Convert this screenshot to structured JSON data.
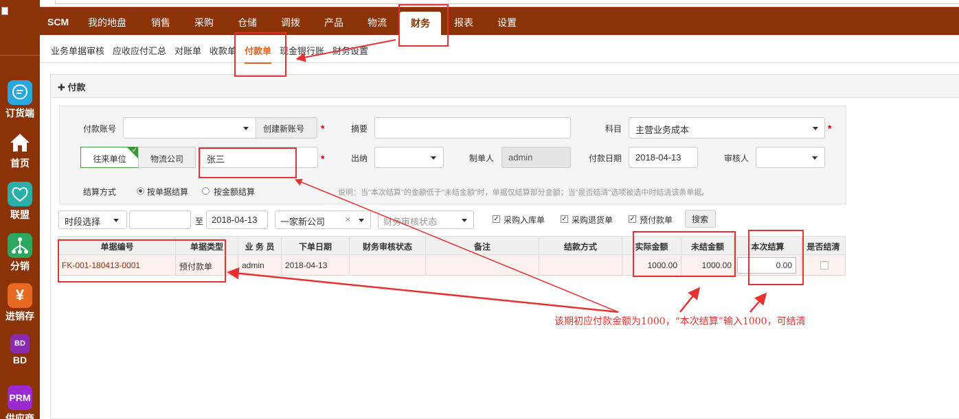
{
  "sidebar": {
    "items": [
      {
        "label": "订货端",
        "icon": "chat-icon",
        "color": "#29a8e0"
      },
      {
        "label": "首页",
        "icon": "home-icon",
        "color": "#8b3207"
      },
      {
        "label": "联盟",
        "icon": "handshake-icon",
        "color": "#2ab0a8"
      },
      {
        "label": "分销",
        "icon": "network-icon",
        "color": "#2aa860"
      },
      {
        "label": "进销存",
        "icon": "yen-icon",
        "color": "#e86a20"
      },
      {
        "label": "BD",
        "icon": "bd-icon",
        "color": "#8a2ab0"
      },
      {
        "label": "供应商",
        "icon": "prm-icon",
        "color": "#9a2ad0"
      }
    ],
    "bd_badge": "BD",
    "prm_badge": "PRM",
    "yen_glyph": "¥"
  },
  "topnav": {
    "brand": "SCM",
    "items": [
      "我的地盘",
      "销售",
      "采购",
      "仓储",
      "调拨",
      "产品",
      "物流",
      "财务",
      "报表",
      "设置"
    ],
    "active": "财务"
  },
  "subnav": {
    "items": [
      "业务单据审核",
      "应收应付汇总",
      "对账单",
      "收款单",
      "付款单",
      "现金银行账",
      "财务设置"
    ],
    "active": "付款单"
  },
  "panel": {
    "title": "付款",
    "plus": "✚"
  },
  "form": {
    "account_label": "付款账号",
    "account_value": "",
    "create_account_btn": "创建新账号",
    "summary_label": "摘要",
    "summary_value": "",
    "subject_label": "科目",
    "subject_value": "主营业务成本",
    "party_toggle_a": "往来单位",
    "party_toggle_b": "物流公司",
    "party_value": "张三",
    "cashier_label": "出纳",
    "cashier_value": "",
    "maker_label": "制单人",
    "maker_value": "admin",
    "pay_date_label": "付款日期",
    "pay_date_value": "2018-04-13",
    "auditor_label": "审核人",
    "auditor_value": "",
    "settle_label": "结算方式",
    "settle_opt_a": "按单据结算",
    "settle_opt_b": "按金额结算",
    "note": "说明：当\"本次结算\"的金额低于\"未结金额\"时，单据仅结算部分金额；当\"是否结清\"选项被选中时结清该条单据。",
    "required_mark": "*"
  },
  "filters": {
    "period_value": "时段选择",
    "date_from": "",
    "to_label": "至",
    "date_to": "2018-04-13",
    "company_value": "一家新公司",
    "clear_glyph": "×",
    "audit_status_placeholder": "财务审核状态",
    "check_a": "采购入库单",
    "check_b": "采购退货单",
    "check_c": "预付款单",
    "check_mark": "✓",
    "search_btn": "搜索"
  },
  "table": {
    "headers": [
      "单据编号",
      "单据类型",
      "业 务 员",
      "下单日期",
      "财务审核状态",
      "备注",
      "结款方式",
      "实际金额",
      "未结金额",
      "本次结算",
      "是否结清"
    ],
    "rows": [
      [
        "FK-001-180413-0001",
        "预付款单",
        "admin",
        "2018-04-13",
        "",
        "",
        "",
        "1000.00",
        "1000.00",
        "0.00",
        ""
      ]
    ]
  },
  "annotation": {
    "text": "该期初应付款金额为1000，“本次结算”输入1000，可结清"
  },
  "colors": {
    "brand": "#8b3207",
    "accent": "#e0601a",
    "annotation": "#e83030"
  }
}
